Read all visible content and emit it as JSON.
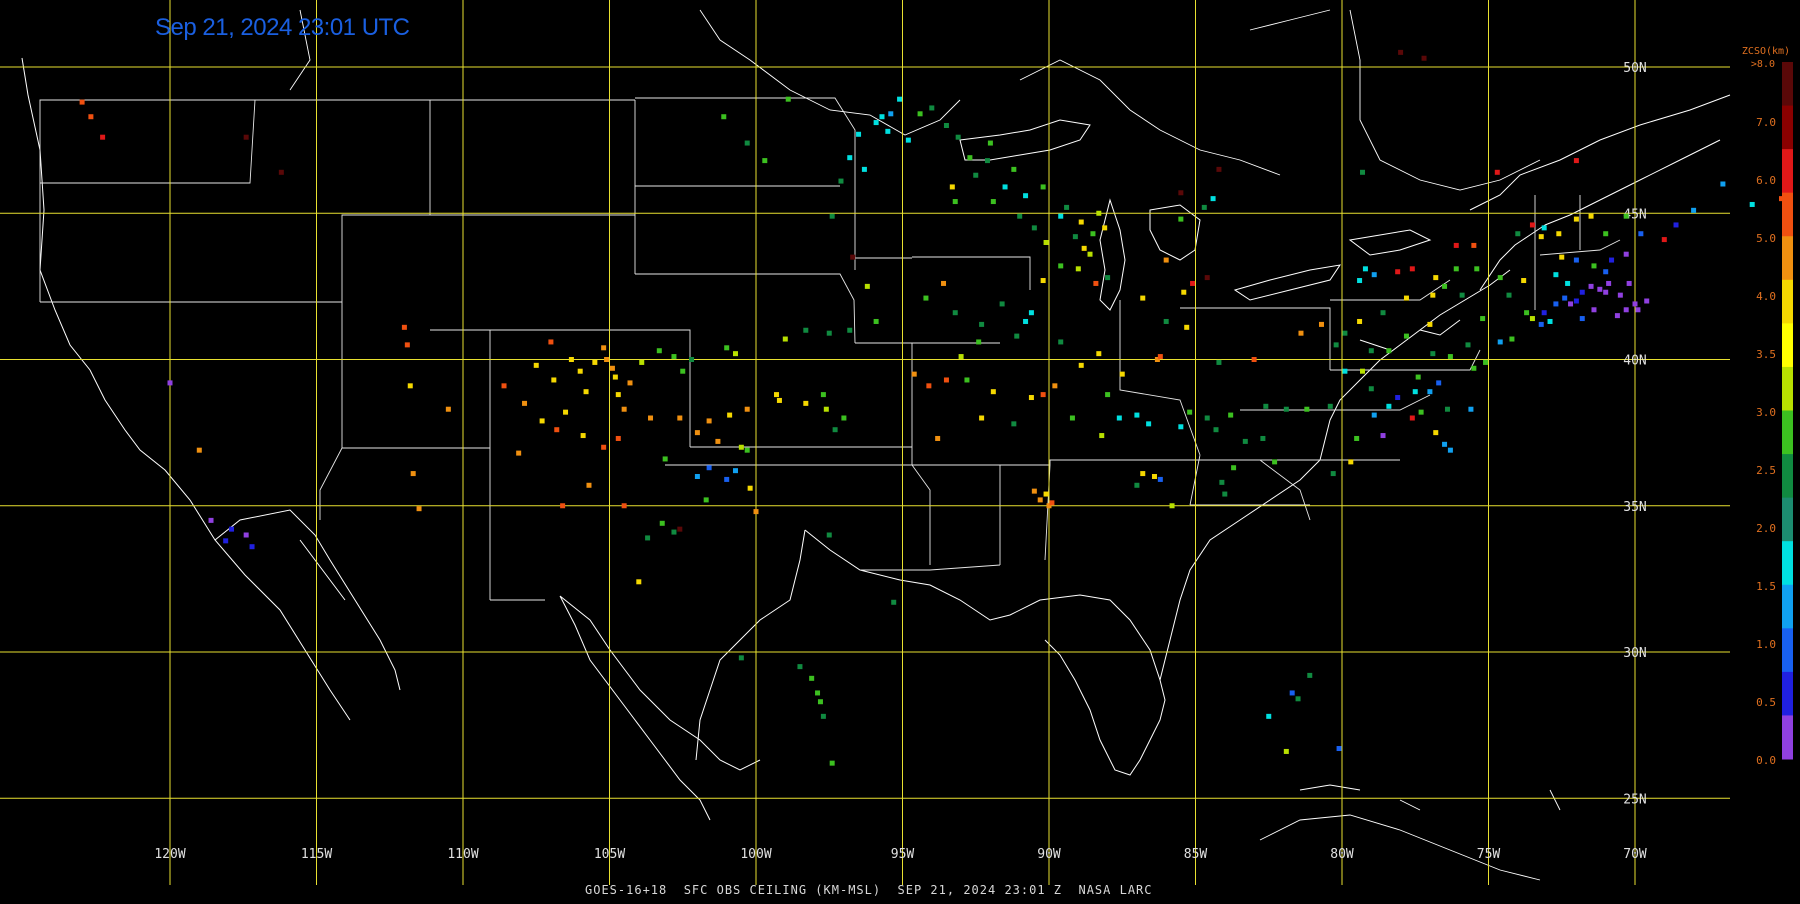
{
  "title": "Sep 21, 2024 23:01 UTC",
  "footer": "GOES-16+18  SFC OBS CEILING (KM-MSL)  SEP 21, 2024 23:01 Z  NASA LARC",
  "colors": {
    "grid": "#e8e030",
    "borders": "#ffffff",
    "title": "#1a5fe0",
    "legend_label": "#e07020"
  },
  "longitudes": [
    "120W",
    "115W",
    "110W",
    "105W",
    "100W",
    "95W",
    "90W",
    "85W",
    "80W",
    "75W",
    "70W"
  ],
  "latitudes": [
    "50N",
    "45N",
    "40N",
    "35N",
    "30N",
    "25N"
  ],
  "legend": {
    "title": "ZCSO(km)",
    "top_label": ">8.0",
    "labels": [
      "7.0",
      "6.0",
      "5.0",
      "4.0",
      "3.5",
      "3.0",
      "2.5",
      "2.0",
      "1.5",
      "1.0",
      "0.5",
      "0.0"
    ],
    "colors": [
      "#5a0808",
      "#8a0000",
      "#e01818",
      "#f05010",
      "#f09010",
      "#f5d800",
      "#ffff00",
      "#b8e000",
      "#3cc020",
      "#108a40",
      "#1c8c70",
      "#00e0e0",
      "#10a0f0",
      "#1860f0",
      "#2020e0",
      "#9040e0"
    ]
  },
  "observations": [
    [
      -122.3,
      47.6,
      "#e01818"
    ],
    [
      -122.7,
      48.3,
      "#f05010"
    ],
    [
      -123.0,
      48.8,
      "#f05010"
    ],
    [
      -117.4,
      47.6,
      "#5a0808"
    ],
    [
      -116.2,
      46.4,
      "#5a0808"
    ],
    [
      -120.0,
      39.2,
      "#9040e0"
    ],
    [
      -118.6,
      34.5,
      "#9040e0"
    ],
    [
      -117.9,
      34.2,
      "#2020e0"
    ],
    [
      -117.4,
      34.0,
      "#9040e0"
    ],
    [
      -118.1,
      33.8,
      "#2020e0"
    ],
    [
      -117.2,
      33.6,
      "#2020e0"
    ],
    [
      -119.0,
      36.9,
      "#f09010"
    ],
    [
      -112.0,
      41.1,
      "#f05010"
    ],
    [
      -111.9,
      40.5,
      "#f05010"
    ],
    [
      -111.8,
      39.1,
      "#f5d800"
    ],
    [
      -110.5,
      38.3,
      "#f09010"
    ],
    [
      -111.7,
      36.1,
      "#f09010"
    ],
    [
      -111.5,
      34.9,
      "#f09010"
    ],
    [
      -108.6,
      39.1,
      "#f05010"
    ],
    [
      -107.9,
      38.5,
      "#f09010"
    ],
    [
      -107.5,
      39.8,
      "#f5d800"
    ],
    [
      -107.0,
      40.6,
      "#f05010"
    ],
    [
      -106.9,
      39.3,
      "#f5d800"
    ],
    [
      -106.3,
      40.0,
      "#f5d800"
    ],
    [
      -106.0,
      39.6,
      "#f5d800"
    ],
    [
      -105.8,
      38.9,
      "#f5d800"
    ],
    [
      -105.5,
      39.9,
      "#f5d800"
    ],
    [
      -105.2,
      40.4,
      "#f09010"
    ],
    [
      -105.1,
      40.0,
      "#f09010"
    ],
    [
      -104.9,
      39.7,
      "#f09010"
    ],
    [
      -104.8,
      39.4,
      "#f5d800"
    ],
    [
      -104.7,
      38.8,
      "#f5d800"
    ],
    [
      -104.5,
      38.3,
      "#f09010"
    ],
    [
      -104.3,
      39.2,
      "#f09010"
    ],
    [
      -103.6,
      38.0,
      "#f09010"
    ],
    [
      -106.5,
      38.2,
      "#f5d800"
    ],
    [
      -107.3,
      37.9,
      "#f5d800"
    ],
    [
      -106.8,
      37.6,
      "#f05010"
    ],
    [
      -105.9,
      37.4,
      "#f5d800"
    ],
    [
      -105.2,
      37.0,
      "#f05010"
    ],
    [
      -104.7,
      37.3,
      "#f05010"
    ],
    [
      -103.9,
      39.9,
      "#b8e000"
    ],
    [
      -103.3,
      40.3,
      "#3cc020"
    ],
    [
      -102.8,
      40.1,
      "#3cc020"
    ],
    [
      -102.2,
      40.0,
      "#108a40"
    ],
    [
      -108.1,
      36.8,
      "#f09010"
    ],
    [
      -106.6,
      35.0,
      "#f05010"
    ],
    [
      -105.7,
      35.7,
      "#f09010"
    ],
    [
      -104.5,
      35.0,
      "#f05010"
    ],
    [
      -103.2,
      34.4,
      "#3cc020"
    ],
    [
      -104.0,
      32.4,
      "#f5d800"
    ],
    [
      -103.7,
      33.9,
      "#108a40"
    ],
    [
      -102.6,
      34.2,
      "#5a0808"
    ],
    [
      -102.6,
      38.0,
      "#f09010"
    ],
    [
      -102.0,
      37.5,
      "#f09010"
    ],
    [
      -101.6,
      37.9,
      "#f09010"
    ],
    [
      -101.3,
      37.2,
      "#f09010"
    ],
    [
      -100.9,
      38.1,
      "#f5d800"
    ],
    [
      -100.3,
      38.3,
      "#f09010"
    ],
    [
      -99.2,
      38.6,
      "#f5d800"
    ],
    [
      -99.3,
      38.8,
      "#f5d800"
    ],
    [
      -98.3,
      38.5,
      "#f5d800"
    ],
    [
      -97.7,
      38.8,
      "#3cc020"
    ],
    [
      -97.6,
      38.3,
      "#b8e000"
    ],
    [
      -97.3,
      37.6,
      "#108a40"
    ],
    [
      -97.0,
      38.0,
      "#3cc020"
    ],
    [
      -101.0,
      40.4,
      "#3cc020"
    ],
    [
      -100.7,
      40.2,
      "#b8e000"
    ],
    [
      -102.5,
      39.6,
      "#3cc020"
    ],
    [
      -102.0,
      36.0,
      "#10a0f0"
    ],
    [
      -101.6,
      36.3,
      "#1860f0"
    ],
    [
      -101.0,
      35.9,
      "#1860f0"
    ],
    [
      -100.7,
      36.2,
      "#10a0f0"
    ],
    [
      -100.2,
      35.6,
      "#f5d800"
    ],
    [
      -100.0,
      34.8,
      "#f09010"
    ],
    [
      -101.7,
      35.2,
      "#3cc020"
    ],
    [
      -102.8,
      34.1,
      "#108a40"
    ],
    [
      -100.3,
      36.9,
      "#3cc020"
    ],
    [
      -100.5,
      37.0,
      "#b8e000"
    ],
    [
      -97.5,
      34.0,
      "#108a40"
    ],
    [
      -103.1,
      36.6,
      "#3cc020"
    ],
    [
      -98.5,
      29.5,
      "#108a40"
    ],
    [
      -98.1,
      29.1,
      "#3cc020"
    ],
    [
      -97.9,
      28.6,
      "#3cc020"
    ],
    [
      -97.8,
      28.3,
      "#3cc020"
    ],
    [
      -97.7,
      27.8,
      "#108a40"
    ],
    [
      -97.4,
      26.2,
      "#3cc020"
    ],
    [
      -100.5,
      29.8,
      "#108a40"
    ],
    [
      -95.3,
      31.7,
      "#108a40"
    ],
    [
      -101.1,
      48.3,
      "#3cc020"
    ],
    [
      -100.3,
      47.4,
      "#108a40"
    ],
    [
      -98.9,
      48.9,
      "#3cc020"
    ],
    [
      -99.7,
      46.8,
      "#3cc020"
    ],
    [
      -97.1,
      46.1,
      "#108a40"
    ],
    [
      -97.4,
      44.9,
      "#108a40"
    ],
    [
      -96.7,
      43.5,
      "#5a0808"
    ],
    [
      -96.2,
      42.5,
      "#b8e000"
    ],
    [
      -95.9,
      41.3,
      "#3cc020"
    ],
    [
      -96.8,
      41.0,
      "#108a40"
    ],
    [
      -97.5,
      40.9,
      "#108a40"
    ],
    [
      -98.3,
      41.0,
      "#108a40"
    ],
    [
      -99.0,
      40.7,
      "#b8e000"
    ],
    [
      -96.8,
      46.9,
      "#00e0e0"
    ],
    [
      -96.5,
      47.7,
      "#00e0e0"
    ],
    [
      -96.3,
      46.5,
      "#00e0e0"
    ],
    [
      -95.9,
      48.1,
      "#00e0e0"
    ],
    [
      -95.7,
      48.3,
      "#00e0e0"
    ],
    [
      -95.5,
      47.8,
      "#00e0e0"
    ],
    [
      -95.4,
      48.4,
      "#10a0f0"
    ],
    [
      -95.1,
      48.9,
      "#00e0e0"
    ],
    [
      -94.8,
      47.5,
      "#00e0e0"
    ],
    [
      -94.4,
      48.4,
      "#3cc020"
    ],
    [
      -94.0,
      48.6,
      "#108a40"
    ],
    [
      -93.5,
      48.0,
      "#108a40"
    ],
    [
      -93.1,
      47.6,
      "#108a40"
    ],
    [
      -92.7,
      46.9,
      "#3cc020"
    ],
    [
      -93.3,
      45.9,
      "#f5d800"
    ],
    [
      -93.2,
      45.4,
      "#3cc020"
    ],
    [
      -92.5,
      46.3,
      "#108a40"
    ],
    [
      -92.1,
      46.8,
      "#108a40"
    ],
    [
      -92.0,
      47.4,
      "#3cc020"
    ],
    [
      -91.5,
      45.9,
      "#00e0e0"
    ],
    [
      -90.8,
      45.6,
      "#00e0e0"
    ],
    [
      -91.2,
      46.5,
      "#3cc020"
    ],
    [
      -91.0,
      44.9,
      "#108a40"
    ],
    [
      -90.5,
      44.5,
      "#108a40"
    ],
    [
      -90.2,
      45.9,
      "#3cc020"
    ],
    [
      -91.9,
      45.4,
      "#3cc020"
    ],
    [
      -89.6,
      44.9,
      "#00e0e0"
    ],
    [
      -89.4,
      45.2,
      "#108a40"
    ],
    [
      -89.1,
      44.2,
      "#108a40"
    ],
    [
      -88.9,
      44.7,
      "#f5d800"
    ],
    [
      -88.5,
      44.3,
      "#3cc020"
    ],
    [
      -88.3,
      45.0,
      "#b8e000"
    ],
    [
      -88.1,
      44.5,
      "#f5d800"
    ],
    [
      -88.6,
      43.6,
      "#b8e000"
    ],
    [
      -88.8,
      43.8,
      "#f5d800"
    ],
    [
      -89.0,
      43.1,
      "#b8e000"
    ],
    [
      -88.4,
      42.6,
      "#f05010"
    ],
    [
      -88.0,
      42.8,
      "#108a40"
    ],
    [
      -89.6,
      43.2,
      "#3cc020"
    ],
    [
      -90.1,
      44.0,
      "#b8e000"
    ],
    [
      -90.2,
      42.7,
      "#f5d800"
    ],
    [
      -93.6,
      42.6,
      "#f09010"
    ],
    [
      -94.2,
      42.1,
      "#3cc020"
    ],
    [
      -93.2,
      41.6,
      "#108a40"
    ],
    [
      -92.3,
      41.2,
      "#108a40"
    ],
    [
      -91.6,
      41.9,
      "#108a40"
    ],
    [
      -90.6,
      41.6,
      "#00e0e0"
    ],
    [
      -90.8,
      41.3,
      "#00e0e0"
    ],
    [
      -91.1,
      40.8,
      "#108a40"
    ],
    [
      -92.4,
      40.6,
      "#3cc020"
    ],
    [
      -93.0,
      40.1,
      "#b8e000"
    ],
    [
      -94.6,
      39.5,
      "#f09010"
    ],
    [
      -94.1,
      39.1,
      "#f05010"
    ],
    [
      -93.5,
      39.3,
      "#f05010"
    ],
    [
      -92.8,
      39.3,
      "#3cc020"
    ],
    [
      -91.9,
      38.9,
      "#f5d800"
    ],
    [
      -90.6,
      38.7,
      "#f5d800"
    ],
    [
      -90.2,
      38.8,
      "#f05010"
    ],
    [
      -91.2,
      37.8,
      "#108a40"
    ],
    [
      -92.3,
      38.0,
      "#f5d800"
    ],
    [
      -93.8,
      37.3,
      "#f09010"
    ],
    [
      -89.6,
      40.6,
      "#108a40"
    ],
    [
      -88.3,
      40.2,
      "#f5d800"
    ],
    [
      -87.5,
      39.5,
      "#f5d800"
    ],
    [
      -88.9,
      39.8,
      "#f5d800"
    ],
    [
      -89.8,
      39.1,
      "#f09010"
    ],
    [
      -88.0,
      38.8,
      "#3cc020"
    ],
    [
      -89.2,
      38.0,
      "#3cc020"
    ],
    [
      -88.2,
      37.4,
      "#b8e000"
    ],
    [
      -86.3,
      40.0,
      "#f09010"
    ],
    [
      -86.2,
      40.1,
      "#f05010"
    ],
    [
      -85.3,
      41.1,
      "#f5d800"
    ],
    [
      -86.8,
      42.1,
      "#f5d800"
    ],
    [
      -86.0,
      41.3,
      "#108a40"
    ],
    [
      -85.4,
      42.3,
      "#f5d800"
    ],
    [
      -86.0,
      43.4,
      "#f09010"
    ],
    [
      -85.1,
      42.6,
      "#e01818"
    ],
    [
      -84.6,
      42.8,
      "#5a0808"
    ],
    [
      -84.7,
      45.2,
      "#108a40"
    ],
    [
      -85.5,
      44.8,
      "#3cc020"
    ],
    [
      -84.4,
      45.5,
      "#00e0e0"
    ],
    [
      -85.5,
      45.7,
      "#5a0808"
    ],
    [
      -84.2,
      46.5,
      "#5a0808"
    ],
    [
      -87.6,
      38.0,
      "#00e0e0"
    ],
    [
      -87.0,
      38.1,
      "#00e0e0"
    ],
    [
      -86.6,
      37.8,
      "#00e0e0"
    ],
    [
      -85.5,
      37.7,
      "#00e0e0"
    ],
    [
      -85.2,
      38.2,
      "#3cc020"
    ],
    [
      -84.6,
      38.0,
      "#108a40"
    ],
    [
      -84.3,
      37.6,
      "#108a40"
    ],
    [
      -83.8,
      38.1,
      "#3cc020"
    ],
    [
      -82.6,
      38.4,
      "#108a40"
    ],
    [
      -83.3,
      37.2,
      "#108a40"
    ],
    [
      -81.9,
      38.3,
      "#108a40"
    ],
    [
      -86.8,
      36.1,
      "#f5d800"
    ],
    [
      -86.4,
      36.0,
      "#f5d800"
    ],
    [
      -86.2,
      35.9,
      "#1860f0"
    ],
    [
      -84.1,
      35.8,
      "#108a40"
    ],
    [
      -83.7,
      36.3,
      "#3cc020"
    ],
    [
      -82.3,
      36.5,
      "#3cc020"
    ],
    [
      -80.3,
      36.1,
      "#108a40"
    ],
    [
      -79.5,
      37.3,
      "#3cc020"
    ],
    [
      -82.7,
      37.3,
      "#108a40"
    ],
    [
      -85.8,
      35.0,
      "#b8e000"
    ],
    [
      -87.0,
      35.7,
      "#108a40"
    ],
    [
      -84.0,
      35.4,
      "#108a40"
    ],
    [
      -90.0,
      35.0,
      "#f09010"
    ],
    [
      -90.3,
      35.2,
      "#f09010"
    ],
    [
      -90.1,
      35.4,
      "#f5d800"
    ],
    [
      -90.5,
      35.5,
      "#f09010"
    ],
    [
      -89.9,
      35.1,
      "#f05010"
    ],
    [
      -83.0,
      40.0,
      "#f05010"
    ],
    [
      -84.2,
      39.9,
      "#108a40"
    ],
    [
      -81.4,
      40.9,
      "#f09010"
    ],
    [
      -80.7,
      41.2,
      "#f09010"
    ],
    [
      -80.2,
      40.5,
      "#108a40"
    ],
    [
      -79.9,
      40.9,
      "#108a40"
    ],
    [
      -78.4,
      40.3,
      "#3cc020"
    ],
    [
      -77.8,
      40.8,
      "#3cc020"
    ],
    [
      -76.9,
      40.2,
      "#108a40"
    ],
    [
      -76.3,
      40.1,
      "#3cc020"
    ],
    [
      -75.7,
      40.5,
      "#108a40"
    ],
    [
      -77.4,
      39.4,
      "#3cc020"
    ],
    [
      -79.9,
      39.6,
      "#00e0e0"
    ],
    [
      -79.0,
      39.0,
      "#108a40"
    ],
    [
      -78.4,
      38.4,
      "#00e0e0"
    ],
    [
      -78.9,
      38.1,
      "#10a0f0"
    ],
    [
      -77.5,
      38.9,
      "#00e0e0"
    ],
    [
      -77.0,
      38.9,
      "#10a0f0"
    ],
    [
      -76.7,
      39.2,
      "#1860f0"
    ],
    [
      -76.4,
      38.3,
      "#108a40"
    ],
    [
      -77.3,
      38.2,
      "#3cc020"
    ],
    [
      -78.1,
      38.7,
      "#2020e0"
    ],
    [
      -77.6,
      38.0,
      "#e01818"
    ],
    [
      -76.8,
      37.5,
      "#f5d800"
    ],
    [
      -76.3,
      36.9,
      "#10a0f0"
    ],
    [
      -76.5,
      37.1,
      "#10a0f0"
    ],
    [
      -75.6,
      38.3,
      "#10a0f0"
    ],
    [
      -75.5,
      39.7,
      "#3cc020"
    ],
    [
      -75.1,
      39.9,
      "#3cc020"
    ],
    [
      -74.6,
      40.6,
      "#10a0f0"
    ],
    [
      -74.2,
      40.7,
      "#3cc020"
    ],
    [
      -79.7,
      36.5,
      "#f5d800"
    ],
    [
      -78.6,
      37.4,
      "#9040e0"
    ],
    [
      -80.4,
      38.4,
      "#108a40"
    ],
    [
      -81.2,
      38.3,
      "#3cc020"
    ],
    [
      -79.3,
      39.6,
      "#b8e000"
    ],
    [
      -79.0,
      40.3,
      "#108a40"
    ],
    [
      -79.4,
      42.7,
      "#00e0e0"
    ],
    [
      -78.9,
      42.9,
      "#10a0f0"
    ],
    [
      -79.2,
      43.1,
      "#00e0e0"
    ],
    [
      -78.1,
      43.0,
      "#e01818"
    ],
    [
      -77.6,
      43.1,
      "#e01818"
    ],
    [
      -76.8,
      42.8,
      "#f5d800"
    ],
    [
      -76.1,
      43.1,
      "#3cc020"
    ],
    [
      -75.4,
      43.1,
      "#3cc020"
    ],
    [
      -74.6,
      42.8,
      "#3cc020"
    ],
    [
      -73.8,
      42.7,
      "#f5d800"
    ],
    [
      -73.7,
      41.6,
      "#3cc020"
    ],
    [
      -74.3,
      42.2,
      "#108a40"
    ],
    [
      -75.9,
      42.2,
      "#108a40"
    ],
    [
      -76.9,
      42.2,
      "#f5d800"
    ],
    [
      -77.8,
      42.1,
      "#f5d800"
    ],
    [
      -75.5,
      43.9,
      "#f05010"
    ],
    [
      -73.5,
      44.6,
      "#e01818"
    ],
    [
      -73.1,
      44.5,
      "#00e0e0"
    ],
    [
      -74.0,
      44.3,
      "#108a40"
    ],
    [
      -76.1,
      43.9,
      "#e01818"
    ],
    [
      -76.5,
      42.5,
      "#3cc020"
    ],
    [
      -75.2,
      41.4,
      "#3cc020"
    ],
    [
      -77.0,
      41.2,
      "#f5d800"
    ],
    [
      -79.4,
      41.3,
      "#f5d800"
    ],
    [
      -78.6,
      41.6,
      "#108a40"
    ],
    [
      -73.2,
      44.2,
      "#f5d800"
    ],
    [
      -72.6,
      44.3,
      "#f5d800"
    ],
    [
      -72.0,
      44.8,
      "#f5d800"
    ],
    [
      -71.5,
      44.9,
      "#f5d800"
    ],
    [
      -71.0,
      44.3,
      "#3cc020"
    ],
    [
      -70.3,
      44.9,
      "#3cc020"
    ],
    [
      -69.8,
      44.3,
      "#1860f0"
    ],
    [
      -69.0,
      44.1,
      "#e01818"
    ],
    [
      -68.6,
      44.6,
      "#2020e0"
    ],
    [
      -68.0,
      45.1,
      "#10a0f0"
    ],
    [
      -72.5,
      43.5,
      "#f5d800"
    ],
    [
      -72.0,
      43.4,
      "#1860f0"
    ],
    [
      -71.4,
      43.2,
      "#3cc020"
    ],
    [
      -71.0,
      43.0,
      "#1860f0"
    ],
    [
      -70.8,
      43.4,
      "#2020e0"
    ],
    [
      -70.3,
      43.6,
      "#9040e0"
    ],
    [
      -72.7,
      42.9,
      "#00e0e0"
    ],
    [
      -72.3,
      42.6,
      "#00e0e0"
    ],
    [
      -71.8,
      42.3,
      "#2020e0"
    ],
    [
      -71.5,
      42.5,
      "#9040e0"
    ],
    [
      -71.2,
      42.4,
      "#9040e0"
    ],
    [
      -71.0,
      42.3,
      "#9040e0"
    ],
    [
      -70.9,
      42.6,
      "#9040e0"
    ],
    [
      -70.5,
      42.2,
      "#9040e0"
    ],
    [
      -70.3,
      41.7,
      "#9040e0"
    ],
    [
      -70.0,
      41.9,
      "#9040e0"
    ],
    [
      -69.9,
      41.7,
      "#9040e0"
    ],
    [
      -70.6,
      41.5,
      "#9040e0"
    ],
    [
      -71.4,
      41.7,
      "#9040e0"
    ],
    [
      -71.8,
      41.4,
      "#1860f0"
    ],
    [
      -72.2,
      41.9,
      "#9040e0"
    ],
    [
      -72.7,
      41.9,
      "#1860f0"
    ],
    [
      -72.9,
      41.3,
      "#00e0e0"
    ],
    [
      -73.1,
      41.6,
      "#2020e0"
    ],
    [
      -73.5,
      41.4,
      "#b8e000"
    ],
    [
      -73.2,
      41.2,
      "#1860f0"
    ],
    [
      -72.4,
      42.1,
      "#1860f0"
    ],
    [
      -72.0,
      42.0,
      "#2020e0"
    ],
    [
      -70.2,
      42.6,
      "#9040e0"
    ],
    [
      -69.6,
      42.0,
      "#9040e0"
    ],
    [
      -78.0,
      50.5,
      "#5a0808"
    ],
    [
      -77.2,
      50.3,
      "#5a0808"
    ],
    [
      -79.3,
      46.4,
      "#108a40"
    ],
    [
      -72.0,
      46.8,
      "#e01818"
    ],
    [
      -74.7,
      46.4,
      "#e01818"
    ],
    [
      -67.0,
      46.0,
      "#10a0f0"
    ],
    [
      -65.0,
      45.5,
      "#f05010"
    ],
    [
      -66.0,
      45.3,
      "#00e0e0"
    ],
    [
      -81.7,
      28.6,
      "#1860f0"
    ],
    [
      -81.5,
      28.4,
      "#108a40"
    ],
    [
      -82.5,
      27.8,
      "#00e0e0"
    ],
    [
      -81.9,
      26.6,
      "#b8e000"
    ],
    [
      -80.1,
      26.7,
      "#1860f0"
    ],
    [
      -81.1,
      29.2,
      "#108a40"
    ]
  ]
}
